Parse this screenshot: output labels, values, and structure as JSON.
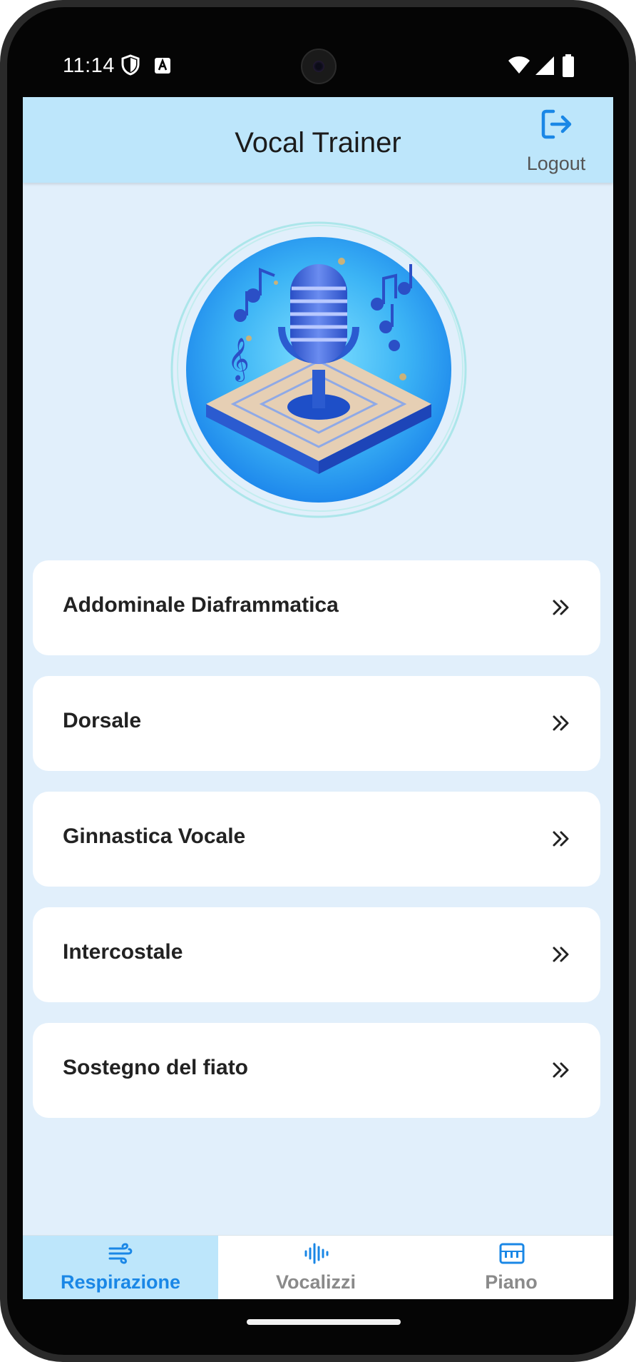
{
  "status_bar": {
    "time": "11:14"
  },
  "header": {
    "title": "Vocal Trainer",
    "logout_label": "Logout"
  },
  "menu": {
    "items": [
      {
        "label": "Addominale Diaframmatica"
      },
      {
        "label": "Dorsale"
      },
      {
        "label": "Ginnastica Vocale"
      },
      {
        "label": "Intercostale"
      },
      {
        "label": "Sostegno del fiato"
      }
    ]
  },
  "bottom_nav": {
    "tabs": [
      {
        "label": "Respirazione",
        "icon": "wind-icon",
        "active": true
      },
      {
        "label": "Vocalizzi",
        "icon": "sound-wave-icon",
        "active": false
      },
      {
        "label": "Piano",
        "icon": "piano-keys-icon",
        "active": false
      }
    ]
  },
  "colors": {
    "accent": "#1a87e6",
    "header_bg": "#bde6fb",
    "screen_bg": "#e1effb",
    "inactive_tab": "#8a8a8a"
  }
}
